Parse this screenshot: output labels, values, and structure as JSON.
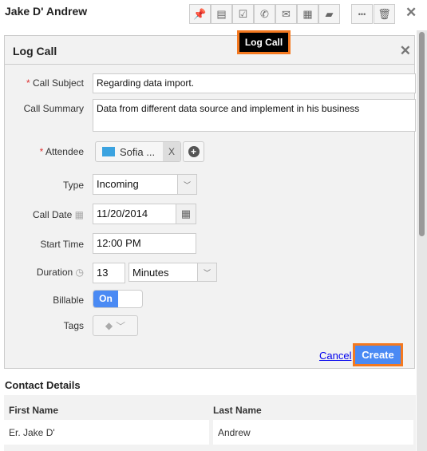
{
  "header": {
    "title": "Jake D' Andrew",
    "toolbar": [
      {
        "icon": "pin-icon",
        "glyph": "📌"
      },
      {
        "icon": "calendar-icon",
        "glyph": "▤"
      },
      {
        "icon": "task-icon",
        "glyph": "☑"
      },
      {
        "icon": "phone-icon",
        "glyph": "✆"
      },
      {
        "icon": "mail-icon",
        "glyph": "✉"
      },
      {
        "icon": "note-icon",
        "glyph": "▦"
      },
      {
        "icon": "folder-icon",
        "glyph": "▰"
      }
    ],
    "more_glyph": "•••",
    "delete_glyph": "🗑",
    "close_glyph": "✕",
    "tooltip": "Log Call"
  },
  "form": {
    "title": "Log Call",
    "close_glyph": "✕",
    "call_subject": {
      "label": "Call Subject",
      "value": "Regarding data import."
    },
    "call_summary": {
      "label": "Call Summary",
      "value": "Data from different data source and implement in his business"
    },
    "attendee": {
      "label": "Attendee",
      "value": "Sofia ...",
      "remove": "X",
      "add": "+"
    },
    "type": {
      "label": "Type",
      "value": "Incoming"
    },
    "call_date": {
      "label": "Call Date",
      "value": "11/20/2014"
    },
    "start_time": {
      "label": "Start Time",
      "value": "12:00 PM"
    },
    "duration": {
      "label": "Duration",
      "value": "13",
      "unit": "Minutes"
    },
    "billable": {
      "label": "Billable",
      "value": "On"
    },
    "tags": {
      "label": "Tags"
    },
    "cancel": "Cancel",
    "create": "Create"
  },
  "contact": {
    "title": "Contact Details",
    "first_name": {
      "label": "First Name",
      "value": "Er. Jake D'"
    },
    "last_name": {
      "label": "Last Name",
      "value": "Andrew"
    }
  },
  "colors": {
    "accent": "#4a8af4",
    "highlight": "#f47920"
  }
}
